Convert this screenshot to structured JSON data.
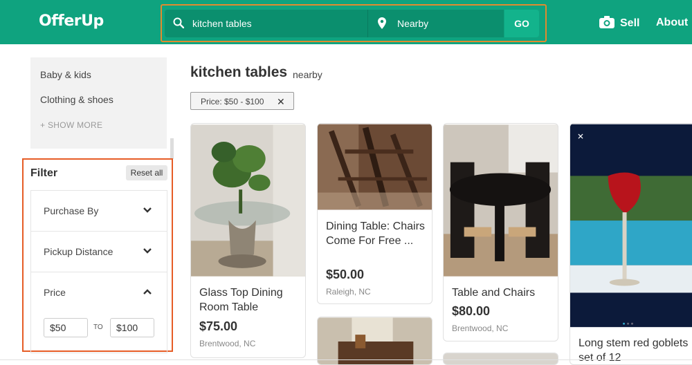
{
  "header": {
    "logo": "OfferUp",
    "search_value": "kitchen tables",
    "location": "Nearby",
    "go_label": "GO",
    "sell_label": "Sell",
    "about_label": "About"
  },
  "sidebar": {
    "categories": [
      "Baby & kids",
      "Clothing & shoes"
    ],
    "show_more": "+ SHOW MORE",
    "filter_title": "Filter",
    "reset_label": "Reset all",
    "filters": [
      "Purchase By",
      "Pickup Distance",
      "Price"
    ],
    "price_min": "$50",
    "price_to": "TO",
    "price_max": "$100"
  },
  "main": {
    "query": "kitchen tables",
    "scope": "nearby",
    "chip_label": "Price: $50 - $100",
    "listings": [
      {
        "title": "Glass Top Dining Room Table",
        "price": "$75.00",
        "location": "Brentwood, NC"
      },
      {
        "title": "Dining Table: Chairs Come For Free ...",
        "price": "$50.00",
        "location": "Raleigh, NC"
      },
      {
        "title": "Table and Chairs",
        "price": "$80.00",
        "location": "Brentwood, NC"
      },
      {
        "title": "Long stem red goblets set of 12",
        "price": "",
        "location": ""
      }
    ]
  },
  "colors": {
    "brand": "#0fa37f",
    "highlight_search": "#e38a2e",
    "highlight_filter": "#e65c25"
  }
}
